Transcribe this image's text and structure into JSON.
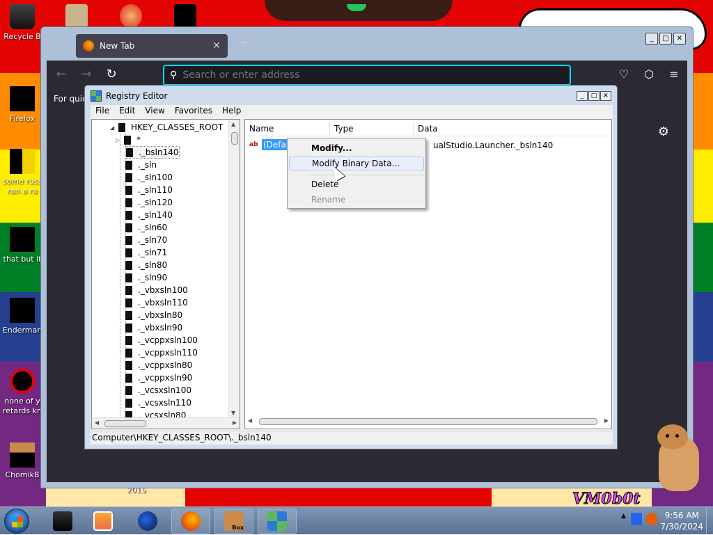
{
  "desktop": {
    "icons": [
      {
        "label": "Recycle B"
      },
      {
        "label": "Firefox"
      },
      {
        "label": "some russ"
      },
      {
        "label": "ran a ra"
      },
      {
        "label": "that but it"
      },
      {
        "label": "Enderman"
      },
      {
        "label": "none of y"
      },
      {
        "label": "retards kn"
      },
      {
        "label": "ChomikB"
      }
    ],
    "bottom_text": "2015",
    "vm_text": "VM0b0t"
  },
  "firefox": {
    "tab_title": "New Tab",
    "new_tab_symbol": "+",
    "url_placeholder": "Search or enter address",
    "for_quick": "For quic"
  },
  "regedit": {
    "title": "Registry Editor",
    "menu": [
      "File",
      "Edit",
      "View",
      "Favorites",
      "Help"
    ],
    "tree_root": "HKEY_CLASSES_ROOT",
    "tree_items": [
      "*",
      "._bsln140",
      "._sln",
      "._sln100",
      "._sln110",
      "._sln120",
      "._sln140",
      "._sln60",
      "._sln70",
      "._sln71",
      "._sln80",
      "._sln90",
      "._vbxsln100",
      "._vbxsln110",
      "._vbxsln80",
      "._vbxsln90",
      "._vcppxsln100",
      "._vcppxsln110",
      "._vcppxsln80",
      "._vcppxsln90",
      "._vcsxsln100",
      "._vcsxsln110",
      "._vcsxsln80"
    ],
    "columns": [
      "Name",
      "Type",
      "Data"
    ],
    "value_name": "(Defaul",
    "value_data": "ualStudio.Launcher._bsln140",
    "status_path": "Computer\\HKEY_CLASSES_ROOT\\._bsln140"
  },
  "context_menu": {
    "modify": "Modify...",
    "modify_binary": "Modify Binary Data...",
    "delete": "Delete",
    "rename": "Rename"
  },
  "taskbar": {
    "time": "9:56 AM",
    "date": "7/30/2024",
    "box_label": "Box"
  }
}
